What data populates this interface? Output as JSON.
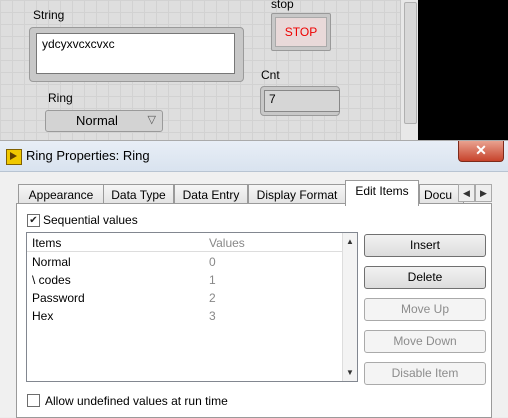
{
  "front_panel": {
    "string_label": "String",
    "string_value": "ydcyxvcxcvxc",
    "stop_label": "stop",
    "stop_button": "STOP",
    "cnt_label": "Cnt",
    "cnt_value": "7",
    "ring_label": "Ring",
    "ring_value": "Normal"
  },
  "dialog": {
    "title": "Ring Properties: Ring",
    "close": "✕",
    "tabs": [
      "Appearance",
      "Data Type",
      "Data Entry",
      "Display Format",
      "Edit Items",
      "Docu"
    ],
    "active_tab": "Edit Items",
    "sequential_label": "Sequential values",
    "sequential_checked": true,
    "columns": [
      "Items",
      "Values"
    ],
    "rows": [
      {
        "item": "Normal",
        "value": "0"
      },
      {
        "item": "\\ codes",
        "value": "1"
      },
      {
        "item": "Password",
        "value": "2"
      },
      {
        "item": "Hex",
        "value": "3"
      }
    ],
    "buttons": {
      "insert": "Insert",
      "delete": "Delete",
      "move_up": "Move Up",
      "move_down": "Move Down",
      "disable_item": "Disable Item"
    },
    "allow_undefined_label": "Allow undefined values at run time",
    "allow_undefined_checked": false
  }
}
